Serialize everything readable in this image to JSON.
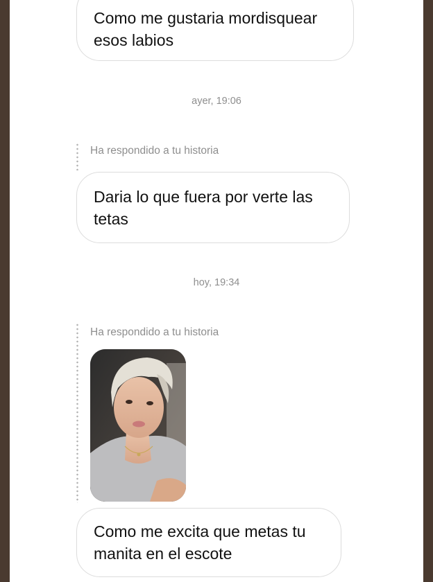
{
  "conversation": {
    "messages": [
      {
        "text": "Como me gustaria mordisquear\nesos labios"
      },
      {
        "text": "Daria lo que fuera por verte las\ntetas"
      },
      {
        "text": "Como me excita que metas tu\nmanita en el escote"
      }
    ],
    "timestamps": [
      "ayer, 19:06",
      "hoy, 19:34"
    ],
    "reply_notes": [
      "Ha respondido a tu historia",
      "Ha respondido a tu historia"
    ],
    "story_image": {
      "icon": "story-photo"
    }
  },
  "colors": {
    "frame": "#4a3a30",
    "background": "#ffffff",
    "bubble_border": "#dcdcdc",
    "meta_text": "#8e8e8e",
    "message_text": "#111111"
  }
}
